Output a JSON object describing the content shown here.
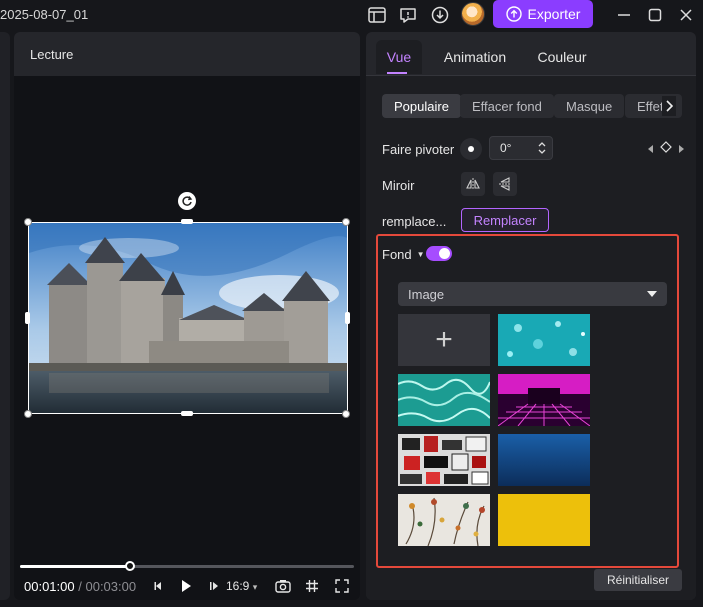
{
  "titlebar": {
    "project_title": "2025-08-07_01",
    "export_label": "Exporter",
    "icons": [
      "layout-icon",
      "feedback-icon",
      "download-icon",
      "avatar",
      "upload-icon",
      "minimize-icon",
      "maximize-icon",
      "close-icon"
    ]
  },
  "player": {
    "header": "Lecture",
    "current_time": "00:01:00",
    "separator": "/",
    "total_time": "00:03:00",
    "progress": 0.33,
    "ratio": "16:9"
  },
  "right": {
    "tabs": [
      {
        "label": "Vue",
        "active": true
      },
      {
        "label": "Animation",
        "active": false
      },
      {
        "label": "Couleur",
        "active": false
      }
    ],
    "subtabs": [
      {
        "label": "Populaire",
        "active": true
      },
      {
        "label": "Effacer fond",
        "active": false
      },
      {
        "label": "Masque",
        "active": false
      },
      {
        "label": "Effets",
        "active": false
      }
    ],
    "rotate": {
      "label": "Faire pivoter",
      "value": "0°"
    },
    "mirror": {
      "label": "Miroir"
    },
    "replace": {
      "label": "remplace...",
      "button": "Remplacer"
    },
    "fond": {
      "label": "Fond",
      "enabled": true,
      "select_value": "Image",
      "add_symbol": "+"
    },
    "reset_label": "Réinitialiser"
  },
  "colors": {
    "accent": "#8b3dff",
    "accent_text": "#c383ff",
    "highlight_border": "#e4493b"
  }
}
